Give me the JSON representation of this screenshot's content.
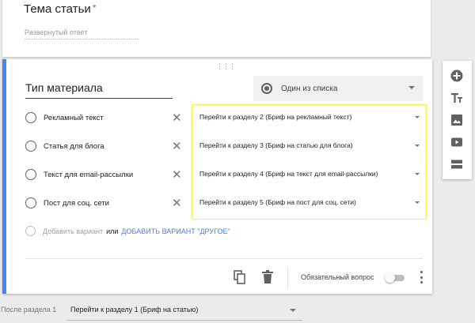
{
  "question_top": {
    "title": "Тема статьи",
    "required_mark": "*",
    "answer_placeholder": "Развернутый ответ"
  },
  "question_main": {
    "title": "Тип материала",
    "type_select": "Один из списка",
    "options": [
      {
        "label": "Рекламный текст",
        "goto": "Перейти к разделу 2 (Бриф на рекламный текст)"
      },
      {
        "label": "Статья для блога",
        "goto": "Перейти к разделу 3 (Бриф на статью для блога)"
      },
      {
        "label": "Текст для email-рассылки",
        "goto": "Перейти к разделу 4 (Бриф на текст для email-рассылки)"
      },
      {
        "label": "Пост для соц. сети",
        "goto": "Перейти к разделу 5 (Бриф на пост для соц. сети)"
      }
    ],
    "add_option": "Добавить вариант",
    "add_or": "или",
    "add_other": "ДОБАВИТЬ ВАРИАНТ \"ДРУГОЕ\"",
    "close_glyph": "✕",
    "required_label": "Обязательный вопрос"
  },
  "after_section": {
    "label": "После раздела 1",
    "value": "Перейти к разделу 1 (Бриф на статью)"
  },
  "colors": {
    "accent": "#4285f4",
    "highlight": "#f3f250",
    "icon": "#616161"
  },
  "icons": [
    "copy-icon",
    "trash-icon",
    "more-vert-icon",
    "add-question-icon",
    "add-title-icon",
    "add-image-icon",
    "add-video-icon",
    "add-section-icon"
  ]
}
